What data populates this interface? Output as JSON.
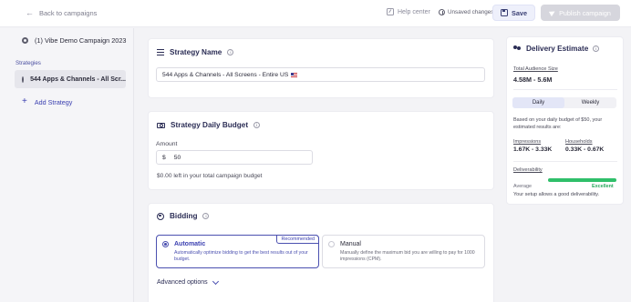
{
  "topbar": {
    "back_label": "Back to campaigns",
    "help_label": "Help center",
    "unsaved_label": "Unsaved changes",
    "save_label": "Save",
    "publish_label": "Publish campaign"
  },
  "sidebar": {
    "campaign_name": "(1) Vibe Demo Campaign 2023",
    "strategies_label": "Strategies",
    "strategy_item": "544 Apps & Channels - All Scr...",
    "add_strategy_label": "Add Strategy"
  },
  "strategy_name": {
    "title": "Strategy Name",
    "value": "544 Apps & Channels - All Screens - Entire US"
  },
  "budget": {
    "title": "Strategy Daily Budget",
    "amount_label": "Amount",
    "currency": "$",
    "amount_value": "50",
    "note": "$0.00 left in your total campaign budget"
  },
  "bidding": {
    "title": "Bidding",
    "auto": {
      "title": "Automatic",
      "desc": "Automatically optimize bidding to get the best results out of your budget.",
      "badge": "Recommended",
      "selected": true
    },
    "manual": {
      "title": "Manual",
      "desc": "Manually define the maximum bid you are willing to pay for 1000 impressions (CPM).",
      "selected": false
    },
    "advanced_label": "Advanced options"
  },
  "delivery": {
    "title": "Delivery Estimate",
    "audience_label": "Total Audience Size",
    "audience_value": "4.58M - 5.6M",
    "toggle": [
      "Daily",
      "Weekly"
    ],
    "toggle_active": "Daily",
    "budget_text": "Based on your daily budget of $50, your estimated results are:",
    "impressions_label": "Impressions",
    "impressions_value": "1.67K - 3.33K",
    "households_label": "Households",
    "households_value": "0.33K - 0.67K",
    "deliverability_label": "Deliverability",
    "deliverability_level": 1.0,
    "average_label": "Average",
    "excellent_label": "Excellent",
    "footer": "Your setup allows a good deliverability."
  }
}
